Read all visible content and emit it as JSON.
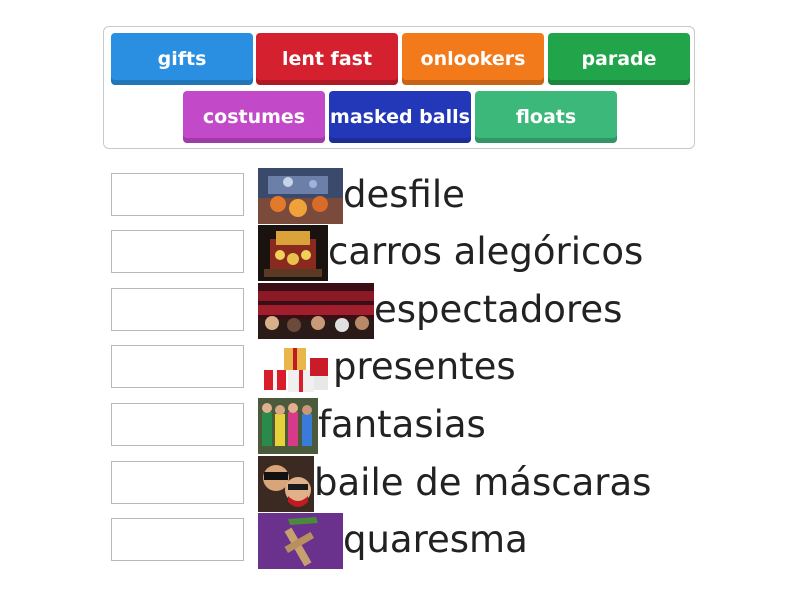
{
  "word_bank": [
    {
      "label": "gifts",
      "color": "#2a8fe0"
    },
    {
      "label": "lent fast",
      "color": "#d4202f"
    },
    {
      "label": "onlookers",
      "color": "#f37a1a"
    },
    {
      "label": "parade",
      "color": "#22a54a"
    },
    {
      "label": "costumes",
      "color": "#c249c8"
    },
    {
      "label": "masked balls",
      "color": "#2338b8"
    },
    {
      "label": "floats",
      "color": "#3cb87a"
    }
  ],
  "rows": [
    {
      "word": "desfile",
      "image": "parade-photo"
    },
    {
      "word": "carros alegóricos",
      "image": "float-photo"
    },
    {
      "word": "espectadores",
      "image": "audience-photo"
    },
    {
      "word": "presentes",
      "image": "gifts-photo"
    },
    {
      "word": "fantasias",
      "image": "costumes-photo"
    },
    {
      "word": "baile de máscaras",
      "image": "masks-photo"
    },
    {
      "word": "quaresma",
      "image": "cross-photo"
    }
  ]
}
